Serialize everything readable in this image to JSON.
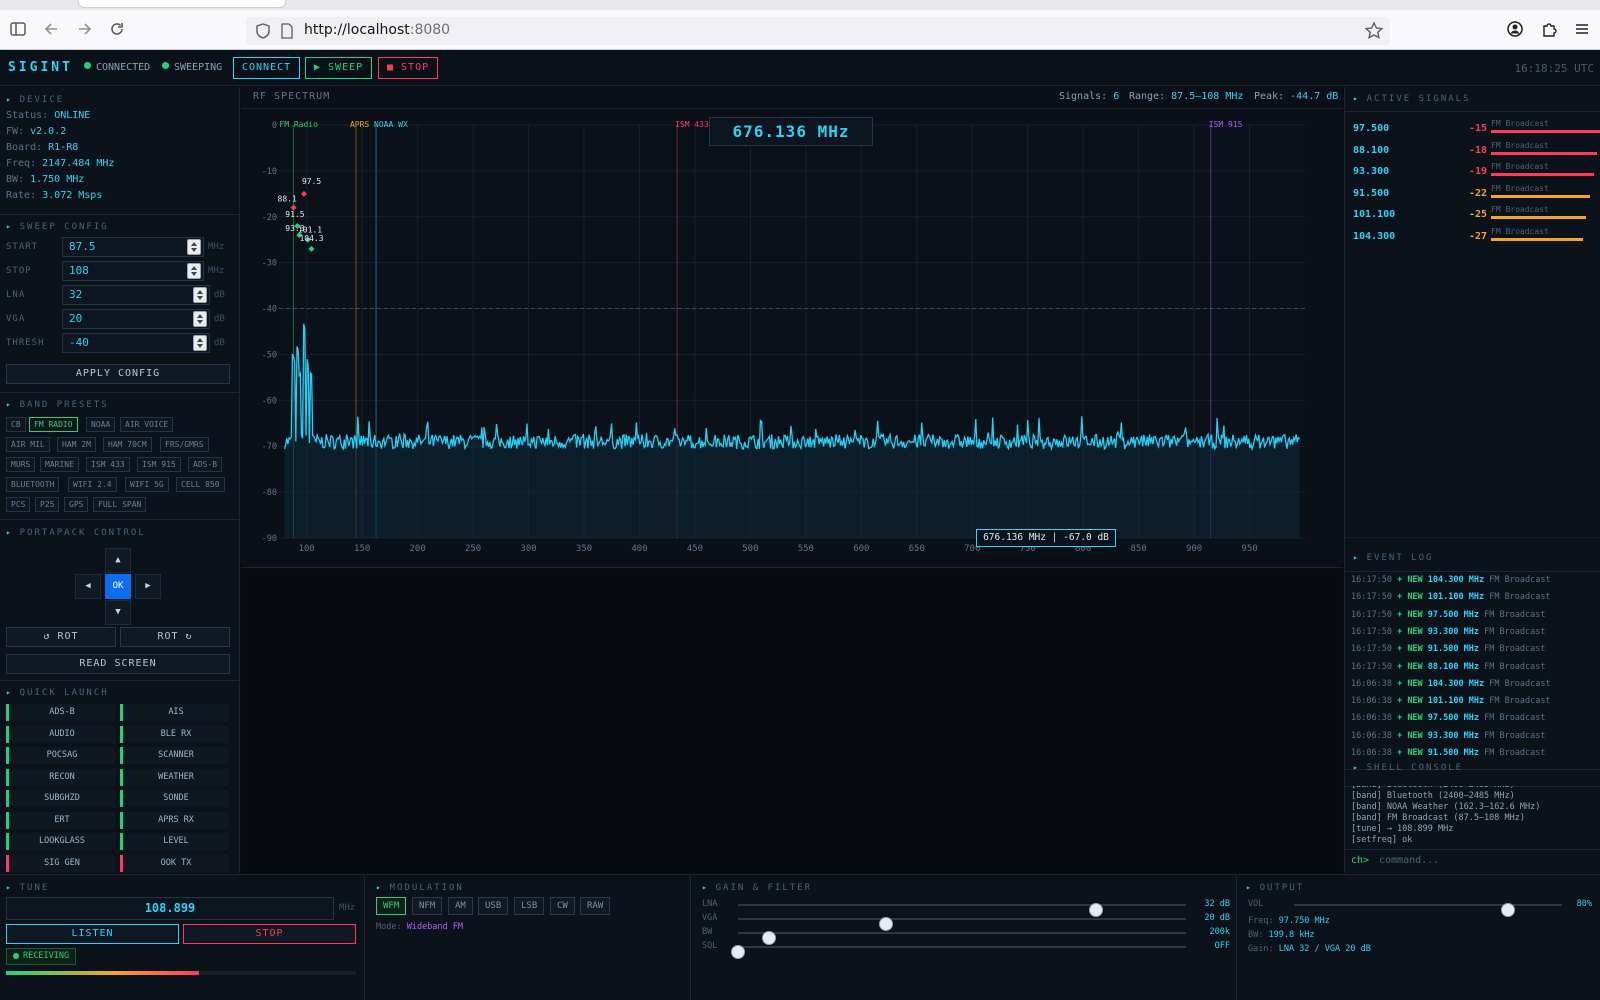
{
  "browser": {
    "url_host": "http://localhost",
    "url_port": ":8080"
  },
  "app": {
    "logo": "SIGINT",
    "status_connected": "CONNECTED",
    "status_sweeping": "SWEEPING",
    "connect_label": "CONNECT",
    "sweep_label": "▶ SWEEP",
    "stop_label": "■ STOP",
    "clock": "16:18:25 UTC",
    "colors": {
      "accent": "#2ed3f5",
      "green": "#22d27a",
      "red": "#ff3b5c",
      "orange": "#f5a623",
      "purple": "#b35cff"
    }
  },
  "device": {
    "title": "DEVICE",
    "rows": [
      {
        "k": "Status:",
        "v": "ONLINE"
      },
      {
        "k": "FW:",
        "v": "v2.0.2"
      },
      {
        "k": "Board:",
        "v": "R1-R8"
      },
      {
        "k": "Freq:",
        "v": "2147.484 MHz"
      },
      {
        "k": "BW:",
        "v": "1.750 MHz"
      },
      {
        "k": "Rate:",
        "v": "3.072 Msps"
      }
    ]
  },
  "sweep": {
    "title": "SWEEP CONFIG",
    "fields": [
      {
        "label": "START",
        "value": "87.5",
        "unit": "MHz"
      },
      {
        "label": "STOP",
        "value": "108",
        "unit": "MHz"
      },
      {
        "label": "LNA",
        "value": "32",
        "unit": "dB"
      },
      {
        "label": "VGA",
        "value": "20",
        "unit": "dB"
      },
      {
        "label": "THRESH",
        "value": "-40",
        "unit": "dB"
      }
    ],
    "apply_label": "APPLY CONFIG"
  },
  "presets": {
    "title": "BAND PRESETS",
    "rows": [
      [
        "CB",
        "FM RADIO",
        "NOAA",
        "AIR VOICE"
      ],
      [
        "AIR MIL",
        "HAM 2M",
        "HAM 70CM",
        "FRS/GMRS"
      ],
      [
        "MURS",
        "MARINE",
        "ISM 433",
        "ISM 915",
        "ADS-B"
      ],
      [
        "BLUETOOTH",
        "WIFI 2.4",
        "WIFI 5G",
        "CELL 850"
      ],
      [
        "PCS",
        "P25",
        "GPS",
        "FULL SPAN"
      ]
    ],
    "selected": "FM RADIO"
  },
  "portapack": {
    "title": "PORTAPACK CONTROL",
    "up": "▲",
    "down": "▼",
    "left": "◀",
    "right": "▶",
    "ok": "OK",
    "rot_left": "↺ ROT",
    "rot_right": "ROT ↻",
    "read_screen": "READ SCREEN"
  },
  "quick_launch": {
    "title": "QUICK LAUNCH",
    "items": [
      "ADS-B",
      "AIS",
      "AUDIO",
      "BLE RX",
      "POCSAG",
      "SCANNER",
      "RECON",
      "WEATHER",
      "SUBGHZD",
      "SONDE",
      "ERT",
      "APRS RX",
      "LOOKGLASS",
      "LEVEL",
      "SIG GEN",
      "OOK TX"
    ]
  },
  "spectrum": {
    "title": "RF SPECTRUM",
    "signals_label": "Signals:",
    "signals_value": "6",
    "range_label": "Range:",
    "range_value": "87.5–108 MHz",
    "peak_label": "Peak:",
    "peak_value": "-44.7 dB",
    "cursor_freq": "676.136 MHz",
    "tooltip": "676.136 MHz | -67.0 dB",
    "band_labels": [
      {
        "label": "FM Radio",
        "freq": 88,
        "color": "#22d27a"
      },
      {
        "label": "APRS",
        "freq": 144.4,
        "color": "#f5a623"
      },
      {
        "label": "NOAA WX",
        "freq": 162.5,
        "color": "#2ed3f5"
      },
      {
        "label": "ISM 433",
        "freq": 433.9,
        "color": "#ff3b5c"
      },
      {
        "label": "ISM 915",
        "freq": 915,
        "color": "#b35cff"
      }
    ],
    "markers": [
      {
        "label": "97.5",
        "freq": 97.5,
        "db": -15
      },
      {
        "label": "88.1",
        "freq": 88.1,
        "db": -18
      },
      {
        "label": "91.5",
        "freq": 91.5,
        "db": -22
      },
      {
        "label": "93.3",
        "freq": 93.3,
        "db": -24
      },
      {
        "label": "101.1",
        "freq": 101.1,
        "db": -25
      },
      {
        "label": "104.3",
        "freq": 104.3,
        "db": -27
      }
    ]
  },
  "chart_data": {
    "type": "line",
    "xlabel": "",
    "ylabel": "",
    "xlim": [
      75,
      1000
    ],
    "ylim": [
      -90,
      0
    ],
    "x_ticks": [
      100,
      150,
      200,
      250,
      300,
      350,
      400,
      450,
      500,
      550,
      600,
      650,
      700,
      750,
      800,
      850,
      900,
      950
    ],
    "y_ticks": [
      0,
      -10,
      -20,
      -30,
      -40,
      -50,
      -60,
      -70,
      -80,
      -90
    ],
    "threshold": -40,
    "noise_floor_db": -69,
    "fm_peaks": [
      {
        "x": 88.1,
        "y": -52
      },
      {
        "x": 91.5,
        "y": -50
      },
      {
        "x": 93.3,
        "y": -55
      },
      {
        "x": 97.5,
        "y": -45
      },
      {
        "x": 101.1,
        "y": -53
      },
      {
        "x": 104.3,
        "y": -55
      }
    ],
    "grid": true
  },
  "active_signals": {
    "title": "ACTIVE SIGNALS",
    "items": [
      {
        "freq": "97.500",
        "db": "-15",
        "label": "FM Broadcast",
        "level": 1.0,
        "color": "#ff3b5c"
      },
      {
        "freq": "88.100",
        "db": "-18",
        "label": "FM Broadcast",
        "level": 0.95,
        "color": "#ff3b5c"
      },
      {
        "freq": "93.300",
        "db": "-19",
        "label": "FM Broadcast",
        "level": 0.92,
        "color": "#ff3b5c"
      },
      {
        "freq": "91.500",
        "db": "-22",
        "label": "FM Broadcast",
        "level": 0.88,
        "color": "#f5a623"
      },
      {
        "freq": "101.100",
        "db": "-25",
        "label": "FM Broadcast",
        "level": 0.85,
        "color": "#f5a623"
      },
      {
        "freq": "104.300",
        "db": "-27",
        "label": "FM Broadcast",
        "level": 0.82,
        "color": "#f5a623"
      }
    ]
  },
  "event_log": {
    "title": "EVENT LOG",
    "items": [
      {
        "t": "16:17:50",
        "k": "+ NEW",
        "f": "104.300 MHz",
        "n": "FM Broadcast"
      },
      {
        "t": "16:17:50",
        "k": "+ NEW",
        "f": "101.100 MHz",
        "n": "FM Broadcast"
      },
      {
        "t": "16:17:50",
        "k": "+ NEW",
        "f": "97.500 MHz",
        "n": "FM Broadcast"
      },
      {
        "t": "16:17:50",
        "k": "+ NEW",
        "f": "93.300 MHz",
        "n": "FM Broadcast"
      },
      {
        "t": "16:17:50",
        "k": "+ NEW",
        "f": "91.500 MHz",
        "n": "FM Broadcast"
      },
      {
        "t": "16:17:50",
        "k": "+ NEW",
        "f": "88.100 MHz",
        "n": "FM Broadcast"
      },
      {
        "t": "16:06:38",
        "k": "+ NEW",
        "f": "104.300 MHz",
        "n": "FM Broadcast"
      },
      {
        "t": "16:06:38",
        "k": "+ NEW",
        "f": "101.100 MHz",
        "n": "FM Broadcast"
      },
      {
        "t": "16:06:38",
        "k": "+ NEW",
        "f": "97.500 MHz",
        "n": "FM Broadcast"
      },
      {
        "t": "16:06:38",
        "k": "+ NEW",
        "f": "93.300 MHz",
        "n": "FM Broadcast"
      },
      {
        "t": "16:06:38",
        "k": "+ NEW",
        "f": "91.500 MHz",
        "n": "FM Broadcast"
      }
    ]
  },
  "shell": {
    "title": "SHELL CONSOLE",
    "lines": [
      "[band] Bluetooth (2400–2485 MHz)",
      "[band] Bluetooth (2400–2485 MHz)",
      "[band] NOAA Weather (162.3–162.6 MHz)",
      "[band] FM Broadcast (87.5–108 MHz)",
      "[tune] → 108.899 MHz",
      "[setfreq] ok"
    ],
    "prompt": "ch>",
    "placeholder": "command..."
  },
  "tune": {
    "title": "TUNE",
    "value": "108.899",
    "unit": "MHz",
    "listen": "LISTEN",
    "stop": "STOP",
    "status": "RECEIVING",
    "level": 0.55
  },
  "modulation": {
    "title": "MODULATION",
    "modes": [
      "WFM",
      "NFM",
      "AM",
      "USB",
      "LSB",
      "CW",
      "RAW"
    ],
    "selected": "WFM",
    "mode_label": "Mode:",
    "mode_value": "Wideband FM"
  },
  "gain": {
    "title": "GAIN & FILTER",
    "sliders": [
      {
        "label": "LNA",
        "value": "32 dB",
        "frac": 0.8
      },
      {
        "label": "VGA",
        "value": "20 dB",
        "frac": 0.33
      },
      {
        "label": "BW",
        "value": "200k",
        "frac": 0.07
      },
      {
        "label": "SQL",
        "value": "OFF",
        "frac": 0.0
      }
    ]
  },
  "output": {
    "title": "OUTPUT",
    "vol_label": "VOL",
    "vol_value": "80%",
    "vol_frac": 0.8,
    "freq_label": "Freq:",
    "freq_value": "97.750 MHz",
    "bw_label": "BW:",
    "bw_value": "199.8 kHz",
    "gain_label": "Gain:",
    "gain_value": "LNA 32 / VGA 20 dB"
  }
}
